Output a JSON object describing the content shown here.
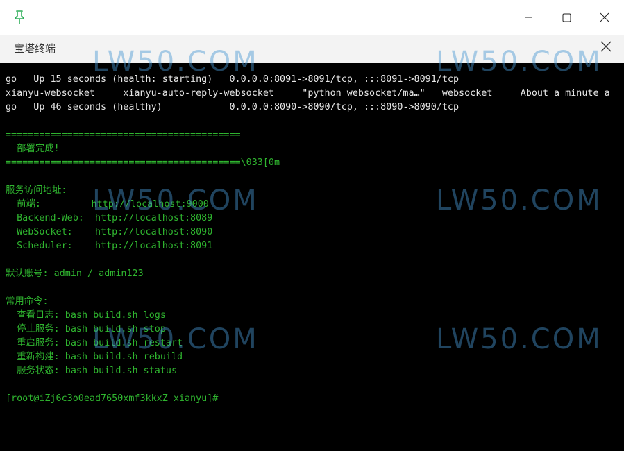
{
  "window": {
    "icons": {
      "pin": "pin-icon",
      "minimize": "minimize-icon",
      "maximize": "maximize-icon",
      "close": "close-icon"
    }
  },
  "tab": {
    "title": "宝塔终端",
    "close_icon": "close-icon"
  },
  "terminal": {
    "lines": [
      {
        "text": "go   Up 15 seconds (health: starting)   0.0.0.0:8091->8091/tcp, :::8091->8091/tcp",
        "color": "#e6e6e6"
      },
      {
        "text": "xianyu-websocket     xianyu-auto-reply-websocket     \"python websocket/ma…\"   websocket     About a minute a",
        "color": "#e6e6e6"
      },
      {
        "text": "go   Up 46 seconds (healthy)            0.0.0.0:8090->8090/tcp, :::8090->8090/tcp",
        "color": "#e6e6e6"
      },
      {
        "text": "",
        "color": "#e6e6e6"
      },
      {
        "text": "==========================================",
        "color": "#2fb52f"
      },
      {
        "text": "  部署完成!",
        "color": "#2fb52f"
      },
      {
        "text": "==========================================\\033[0m",
        "color": "#2fb52f"
      },
      {
        "text": "",
        "color": "#e6e6e6"
      },
      {
        "text": "服务访问地址:",
        "color": "#2fb52f"
      },
      {
        "text": "  前端:         http://localhost:9000",
        "color": "#2fb52f"
      },
      {
        "text": "  Backend-Web:  http://localhost:8089",
        "color": "#2fb52f"
      },
      {
        "text": "  WebSocket:    http://localhost:8090",
        "color": "#2fb52f"
      },
      {
        "text": "  Scheduler:    http://localhost:8091",
        "color": "#2fb52f"
      },
      {
        "text": "",
        "color": "#e6e6e6"
      },
      {
        "text": "默认账号: admin / admin123",
        "color": "#2fb52f"
      },
      {
        "text": "",
        "color": "#e6e6e6"
      },
      {
        "text": "常用命令:",
        "color": "#2fb52f"
      },
      {
        "text": "  查看日志: bash build.sh logs",
        "color": "#2fb52f"
      },
      {
        "text": "  停止服务: bash build.sh stop",
        "color": "#2fb52f"
      },
      {
        "text": "  重启服务: bash build.sh restart",
        "color": "#2fb52f"
      },
      {
        "text": "  重新构建: bash build.sh rebuild",
        "color": "#2fb52f"
      },
      {
        "text": "  服务状态: bash build.sh status",
        "color": "#2fb52f"
      },
      {
        "text": "",
        "color": "#e6e6e6"
      },
      {
        "text": "[root@iZj6c3o0ead7650xmf3kkxZ xianyu]#",
        "color": "#2fb52f"
      }
    ]
  },
  "watermark": {
    "text": "LW50.COM",
    "color": "#4696d2"
  }
}
